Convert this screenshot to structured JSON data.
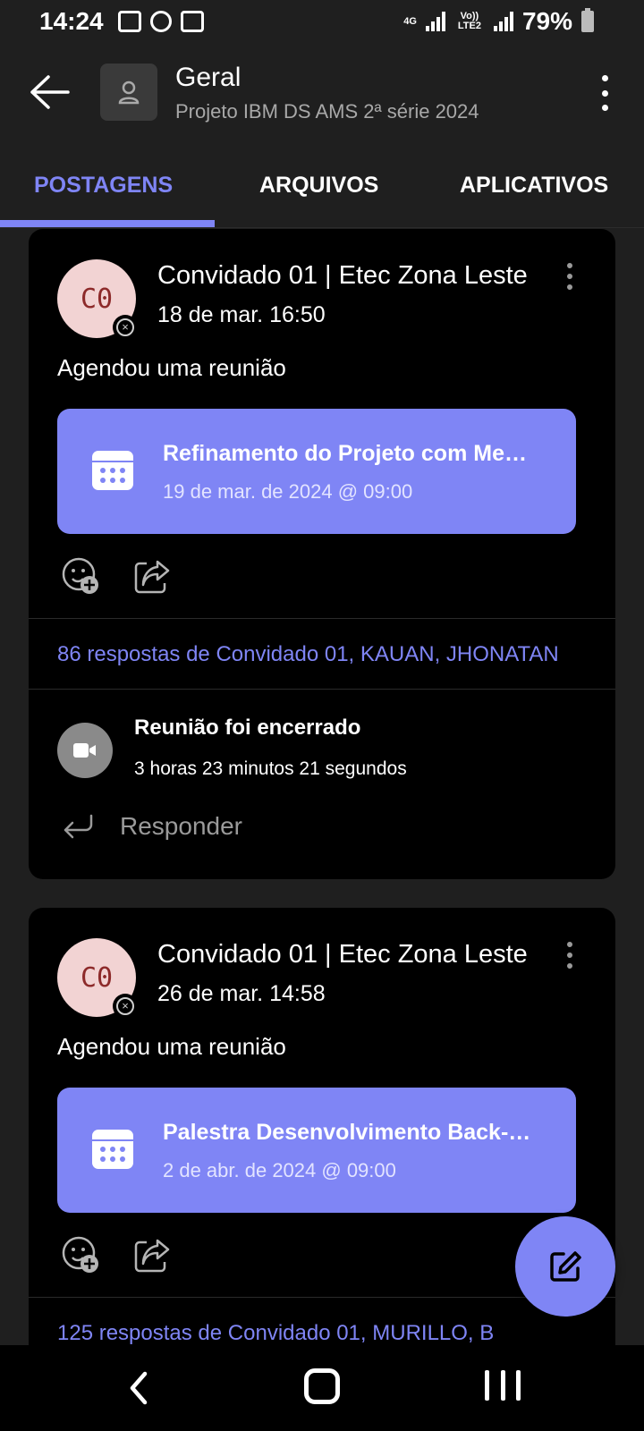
{
  "status_bar": {
    "time": "14:24",
    "network_top": "4G",
    "network_volte": "Vo)) LTE2",
    "battery": "79%"
  },
  "header": {
    "title": "Geral",
    "subtitle": "Projeto IBM DS AMS 2ª série 2024"
  },
  "tabs": [
    {
      "label": "POSTAGENS",
      "active": true
    },
    {
      "label": "ARQUIVOS",
      "active": false
    },
    {
      "label": "APLICATIVOS",
      "active": false
    }
  ],
  "posts": [
    {
      "avatar_initials": "C0",
      "author": "Convidado 01 | Etec Zona Leste",
      "date": "18 de mar. 16:50",
      "text": "Agendou uma reunião",
      "meeting": {
        "title": "Refinamento do Projeto com Mentores",
        "date": "19 de mar. de 2024 @ 09:00"
      },
      "replies": "86 respostas de Convidado 01, KAUAN, JHONATAN",
      "call": {
        "title": "Reunião foi encerrado",
        "duration": "3 horas 23 minutos 21 segundos"
      },
      "reply_label": "Responder"
    },
    {
      "avatar_initials": "C0",
      "author": "Convidado 01 | Etec Zona Leste",
      "date": "26 de mar. 14:58",
      "text": "Agendou uma reunião",
      "meeting": {
        "title": "Palestra Desenvolvimento Back-end",
        "date": "2 de abr. de 2024 @ 09:00"
      },
      "replies": "125 respostas de Convidado 01, MURILLO, B"
    }
  ],
  "colors": {
    "accent": "#7f85f5",
    "background": "#1f1f1f",
    "card": "#000000",
    "avatar_bg": "#f2d3d3",
    "avatar_text": "#8d2a2a"
  },
  "icons": {
    "back": "arrow-left-icon",
    "team": "person-icon",
    "more": "more-vertical-icon",
    "calendar": "calendar-icon",
    "reaction": "add-reaction-icon",
    "share": "share-icon",
    "video": "video-camera-icon",
    "reply": "reply-icon",
    "compose": "compose-icon"
  }
}
